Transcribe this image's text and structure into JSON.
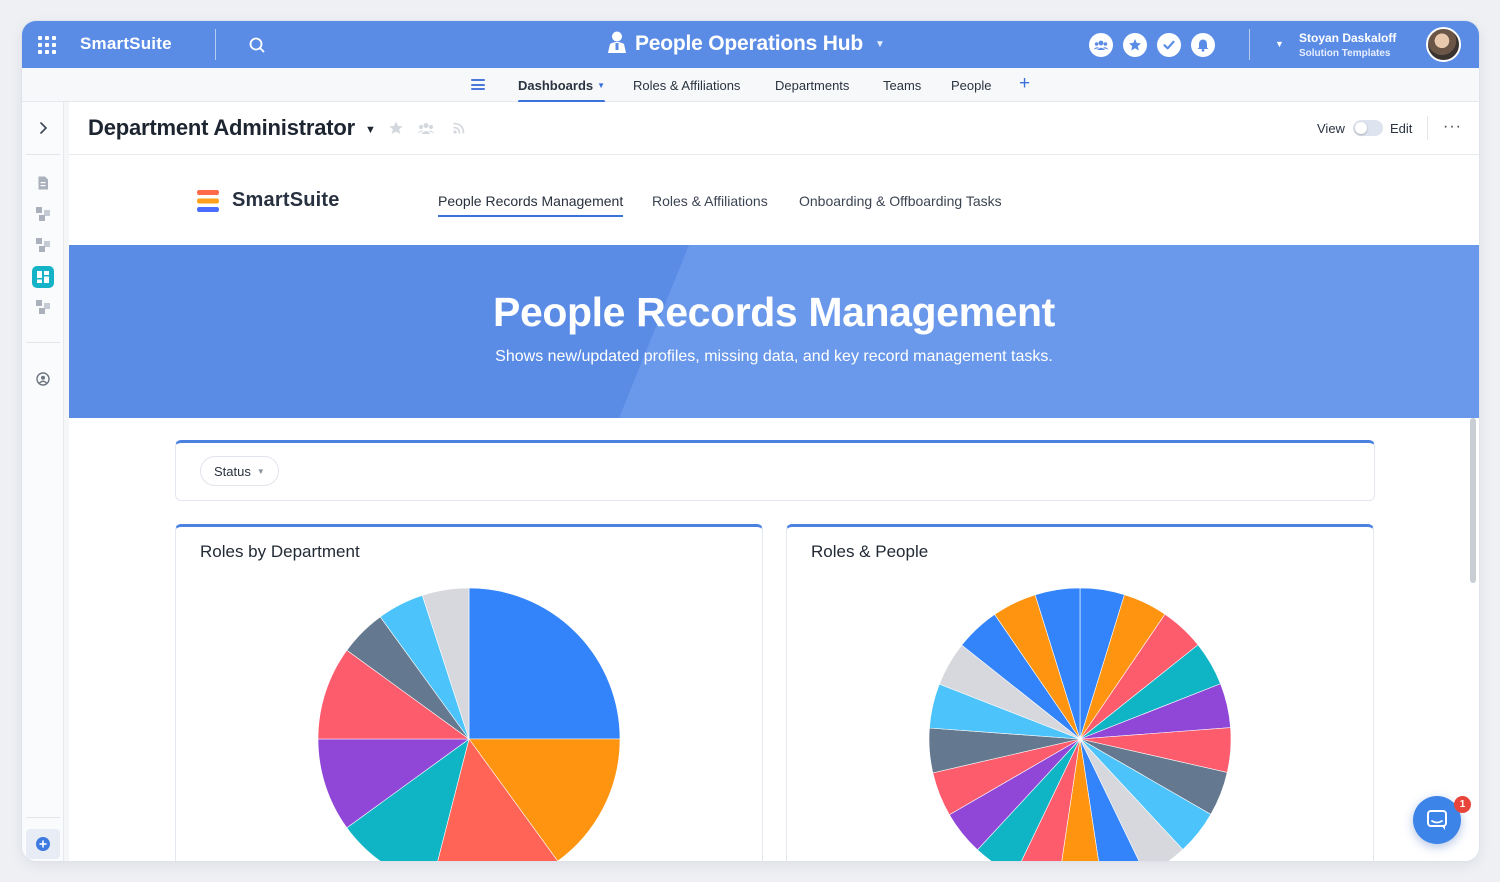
{
  "topbar": {
    "brand": "SmartSuite",
    "hub_title": "People Operations Hub",
    "user_name": "Stoyan Daskaloff",
    "user_subtitle": "Solution Templates",
    "icons": [
      "apps-grid-icon",
      "search-icon",
      "person-icon",
      "members-icon",
      "star-icon",
      "check-icon",
      "bell-icon"
    ]
  },
  "tabs": {
    "items": [
      {
        "label": "Dashboards",
        "active": true
      },
      {
        "label": "Roles & Affiliations",
        "active": false
      },
      {
        "label": "Departments",
        "active": false
      },
      {
        "label": "Teams",
        "active": false
      },
      {
        "label": "People",
        "active": false
      }
    ],
    "add_label": "+"
  },
  "page": {
    "title": "Department Administrator",
    "view_label": "View",
    "edit_label": "Edit",
    "more_label": "···",
    "edit_mode": false
  },
  "dashboard": {
    "brand": "SmartSuite",
    "nav": [
      {
        "label": "People Records Management",
        "active": true
      },
      {
        "label": "Roles & Affiliations",
        "active": false
      },
      {
        "label": "Onboarding & Offboarding Tasks",
        "active": false
      }
    ],
    "hero_title": "People Records Management",
    "hero_subtitle": "Shows new/updated profiles, missing data, and key record management tasks.",
    "filter_label": "Status"
  },
  "chat": {
    "badge_count": "1"
  },
  "colors": {
    "accent": "#5a8ce6",
    "tab_underline": "#3a72dc",
    "palette": [
      "#3384fb",
      "#ff9410",
      "#ff6457",
      "#0fb4c5",
      "#9047d8",
      "#fd5c6d",
      "#64788f",
      "#4cc4fb",
      "#d6d8de"
    ]
  },
  "chart_data": [
    {
      "type": "pie",
      "title": "Roles by Department",
      "slices": [
        {
          "value": 25.0,
          "color": "#3384fb"
        },
        {
          "value": 15.0,
          "color": "#ff9410"
        },
        {
          "value": 14.0,
          "color": "#ff6457"
        },
        {
          "value": 11.0,
          "color": "#0fb4c5"
        },
        {
          "value": 10.0,
          "color": "#9047d8"
        },
        {
          "value": 10.0,
          "color": "#fd5c6d"
        },
        {
          "value": 5.0,
          "color": "#64788f"
        },
        {
          "value": 5.0,
          "color": "#4cc4fb"
        },
        {
          "value": 5.0,
          "color": "#d6d8de"
        }
      ]
    },
    {
      "type": "pie",
      "title": "Roles & People",
      "slices": [
        {
          "value": 4.76,
          "color": "#3384fb"
        },
        {
          "value": 4.76,
          "color": "#ff9410"
        },
        {
          "value": 4.76,
          "color": "#fd5c6d"
        },
        {
          "value": 4.76,
          "color": "#0fb4c5"
        },
        {
          "value": 4.76,
          "color": "#9047d8"
        },
        {
          "value": 4.76,
          "color": "#fd5c6d"
        },
        {
          "value": 4.76,
          "color": "#64788f"
        },
        {
          "value": 4.76,
          "color": "#4cc4fb"
        },
        {
          "value": 4.76,
          "color": "#d6d8de"
        },
        {
          "value": 4.76,
          "color": "#3384fb"
        },
        {
          "value": 4.76,
          "color": "#ff9410"
        },
        {
          "value": 4.76,
          "color": "#fd5c6d"
        },
        {
          "value": 4.76,
          "color": "#0fb4c5"
        },
        {
          "value": 4.76,
          "color": "#9047d8"
        },
        {
          "value": 4.76,
          "color": "#fd5c6d"
        },
        {
          "value": 4.76,
          "color": "#64788f"
        },
        {
          "value": 4.76,
          "color": "#4cc4fb"
        },
        {
          "value": 4.76,
          "color": "#d6d8de"
        },
        {
          "value": 4.76,
          "color": "#3384fb"
        },
        {
          "value": 4.76,
          "color": "#ff9410"
        },
        {
          "value": 4.8,
          "color": "#3384fb"
        }
      ]
    }
  ]
}
